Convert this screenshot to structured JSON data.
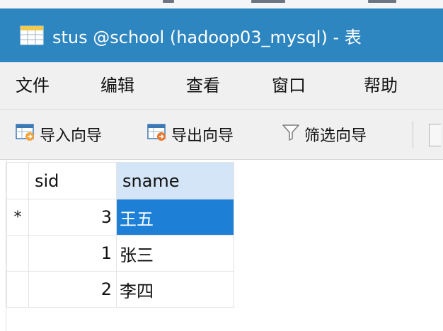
{
  "window": {
    "title": "stus @school (hadoop03_mysql) - 表",
    "titlebar_color": "#2e86c1"
  },
  "menubar": {
    "items": [
      "文件",
      "编辑",
      "查看",
      "窗口",
      "帮助"
    ]
  },
  "toolbar": {
    "import_label": "导入向导",
    "export_label": "导出向导",
    "filter_label": "筛选向导"
  },
  "grid": {
    "columns": [
      "sid",
      "sname"
    ],
    "rows": [
      {
        "indicator": "*",
        "sid": "3",
        "sname": "王五"
      },
      {
        "indicator": "",
        "sid": "1",
        "sname": "张三"
      },
      {
        "indicator": "",
        "sid": "2",
        "sname": "李四"
      }
    ],
    "selected_color": "#1e7fd6",
    "header_highlight_color": "#d4e5f7"
  },
  "icons": {
    "title": "table-icon",
    "import": "import-wizard-icon",
    "export": "export-wizard-icon",
    "filter": "filter-icon"
  }
}
